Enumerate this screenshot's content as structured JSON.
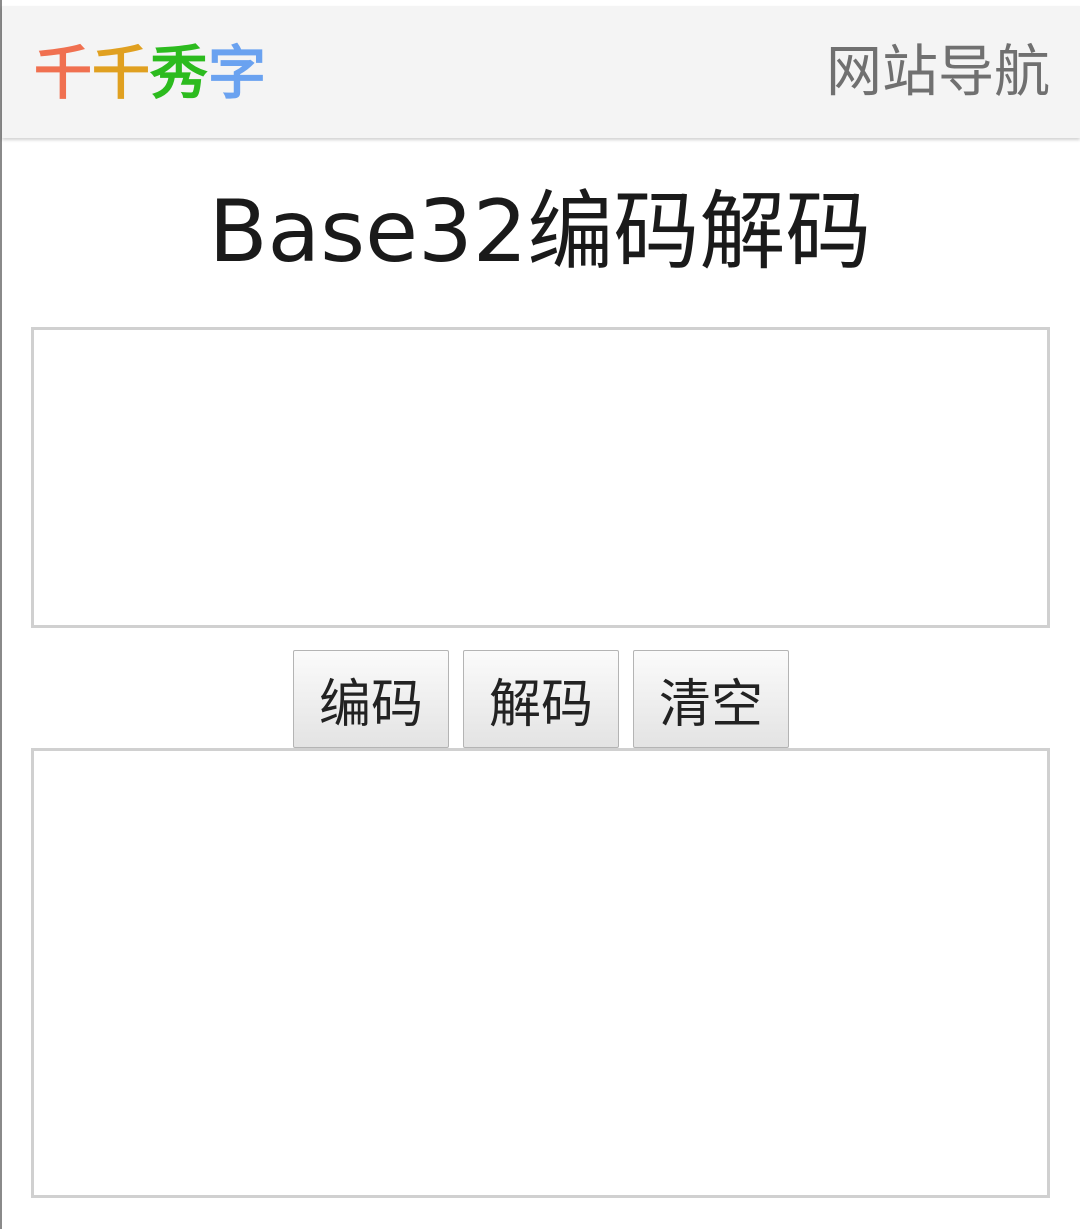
{
  "header": {
    "logo_chars": [
      {
        "char": "千",
        "color": "#f07050"
      },
      {
        "char": "千",
        "color": "#e0a020"
      },
      {
        "char": "秀",
        "color": "#2cbb1e"
      },
      {
        "char": "字",
        "color": "#6aa2f0"
      }
    ],
    "nav_label": "网站导航"
  },
  "main": {
    "title": "Base32编码解码",
    "input": {
      "value": "",
      "placeholder": ""
    },
    "buttons": {
      "encode": "编码",
      "decode": "解码",
      "clear": "清空"
    },
    "output": {
      "value": "",
      "placeholder": ""
    }
  }
}
